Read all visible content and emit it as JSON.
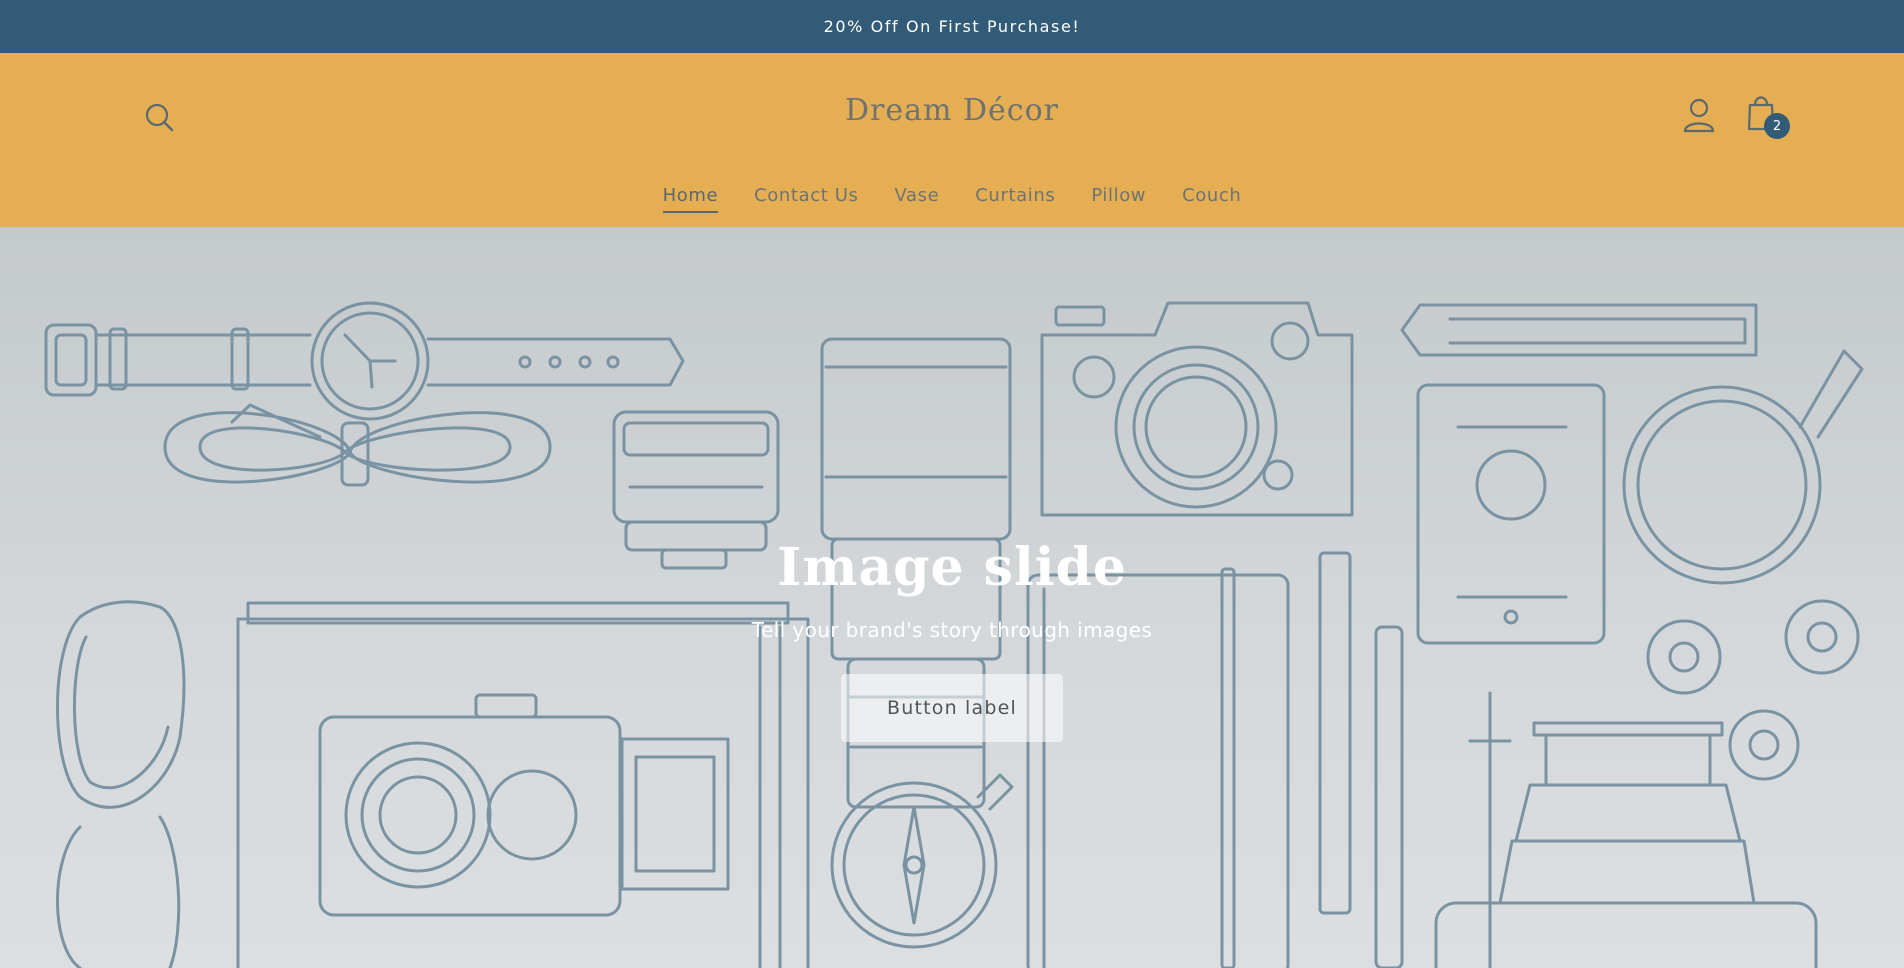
{
  "announcement": {
    "text": "20% Off On First Purchase!"
  },
  "header": {
    "logo": "Dream Décor",
    "cart_count": "2",
    "search_icon": "search-icon",
    "account_icon": "account-icon",
    "cart_icon": "shopping-bag-icon",
    "nav": [
      {
        "label": "Home"
      },
      {
        "label": "Contact Us"
      },
      {
        "label": "Vase"
      },
      {
        "label": "Curtains"
      },
      {
        "label": "Pillow"
      },
      {
        "label": "Couch"
      }
    ]
  },
  "hero": {
    "title": "Image slide",
    "subtitle": "Tell your brand's story through images",
    "button_label": "Button label"
  },
  "colors": {
    "announcement_bg": "#325b77",
    "header_bg": "#e6ae52",
    "illustration_stroke": "#7a93a3",
    "text_white": "#ffffff"
  }
}
